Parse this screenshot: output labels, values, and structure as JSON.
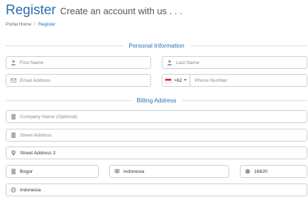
{
  "header": {
    "title": "Register",
    "subtitle": "Create an account with us . . ."
  },
  "breadcrumb": {
    "home": "Portal Home",
    "separator": "/",
    "current": "Register"
  },
  "sections": {
    "personal": "Personal Information",
    "billing": "Billing Address"
  },
  "personal": {
    "first_name": {
      "placeholder": "First Name",
      "icon": "user-icon"
    },
    "last_name": {
      "placeholder": "Last Name",
      "icon": "user-icon"
    },
    "email": {
      "placeholder": "Email Address",
      "icon": "envelope-icon"
    },
    "phone": {
      "placeholder": "Phone Number",
      "dial_code": "+62",
      "country_flag": "indonesia-flag-icon"
    }
  },
  "billing": {
    "company": {
      "placeholder": "Company Name (Optional)",
      "icon": "building-icon"
    },
    "street1": {
      "placeholder": "Street Address",
      "icon": "building-icon"
    },
    "street2": {
      "placeholder": "Street Address 2",
      "icon": "map-marker-icon"
    },
    "city": {
      "value": "Bogor",
      "icon": "building-icon"
    },
    "state": {
      "value": "indonesia",
      "icon": "signpost-icon"
    },
    "postcode": {
      "value": "16820",
      "icon": "circle-icon"
    },
    "country": {
      "value": "Indonesia",
      "icon": "globe-icon"
    }
  },
  "colors": {
    "accent": "#2a6fb0",
    "border": "#cfcfcf",
    "placeholder": "#8a8a8a"
  }
}
